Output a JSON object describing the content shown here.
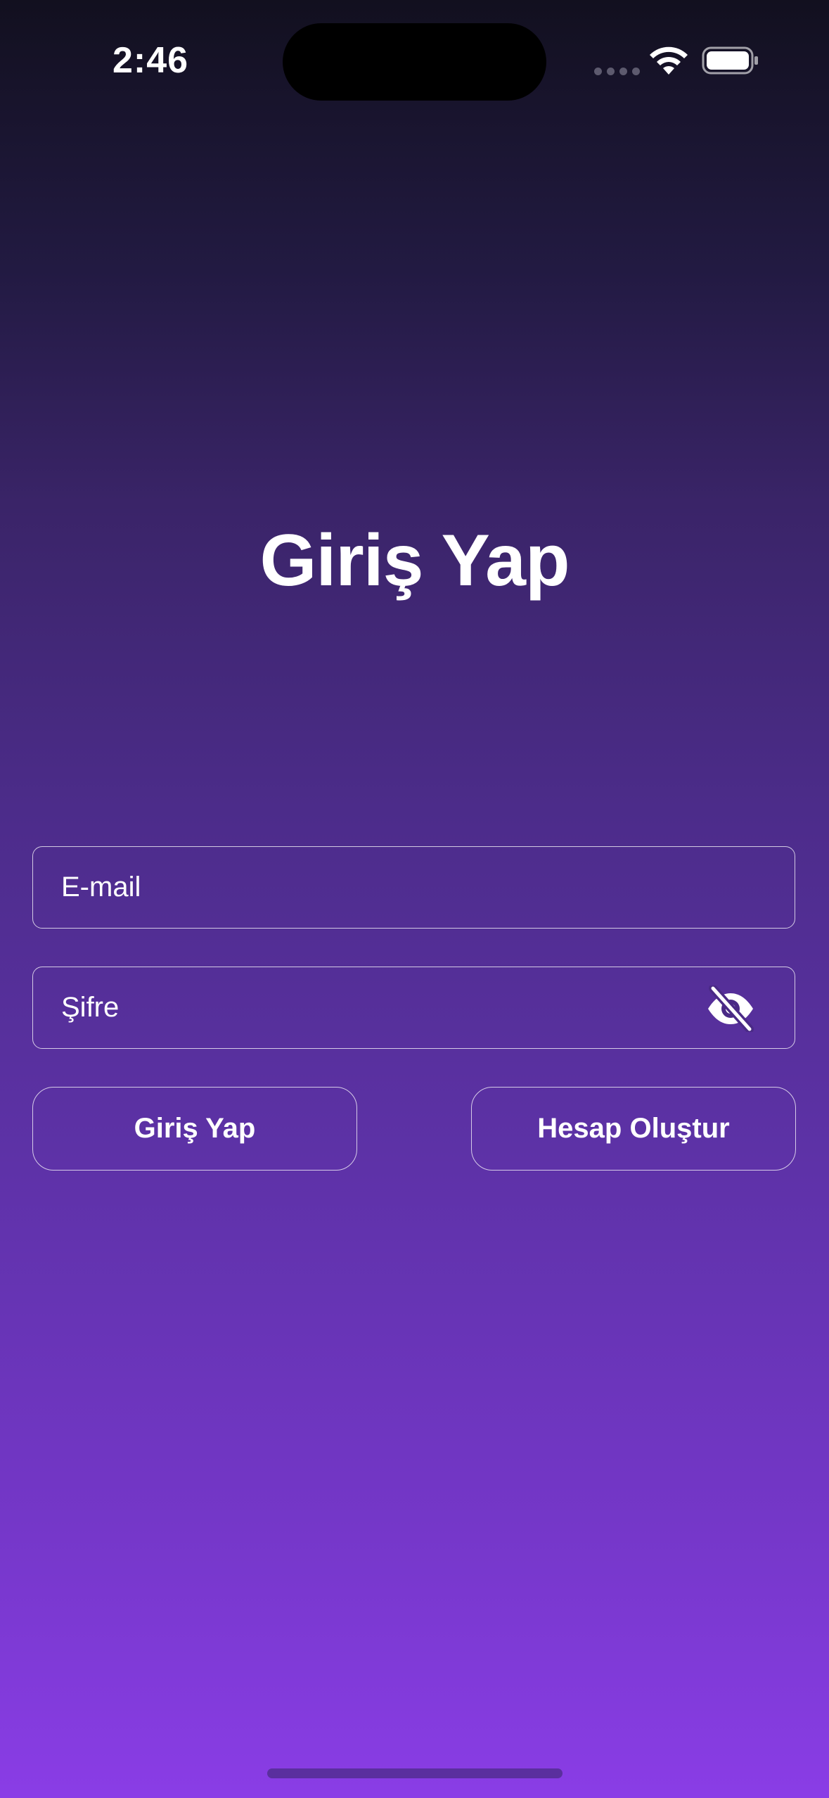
{
  "status_bar": {
    "time": "2:46",
    "icons": [
      "cellular-signal-icon",
      "wifi-icon",
      "battery-icon"
    ]
  },
  "screen": {
    "title": "Giriş Yap"
  },
  "form": {
    "email_placeholder": "E-mail",
    "email_value": "",
    "password_placeholder": "Şifre",
    "password_value": "",
    "password_toggle_icon": "eye-off-icon"
  },
  "actions": {
    "login_label": "Giriş Yap",
    "register_label": "Hesap Oluştur"
  },
  "colors": {
    "gradient_top": "#12101f",
    "gradient_bottom": "#8a3de6",
    "text": "#ffffff",
    "border": "#e8e3f5"
  }
}
